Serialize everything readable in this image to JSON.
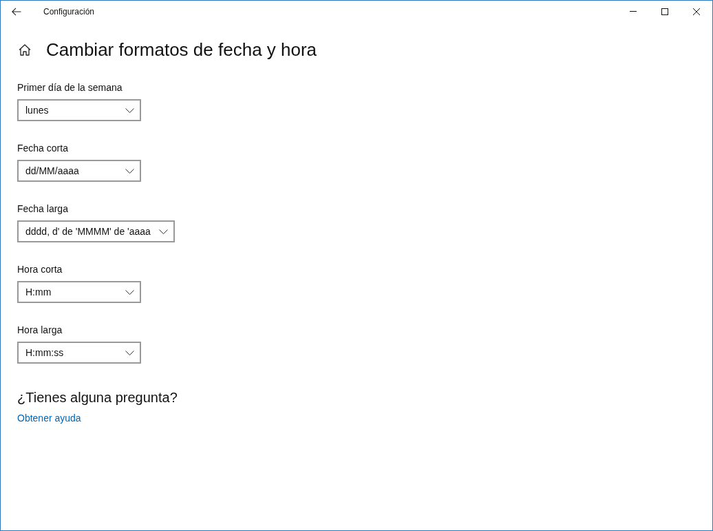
{
  "window": {
    "title": "Configuración"
  },
  "page": {
    "title": "Cambiar formatos de fecha y hora"
  },
  "settings": [
    {
      "label": "Primer día de la semana",
      "value": "lunes"
    },
    {
      "label": "Fecha corta",
      "value": "dd/MM/aaaa"
    },
    {
      "label": "Fecha larga",
      "value": "dddd, d' de 'MMMM' de 'aaaa"
    },
    {
      "label": "Hora corta",
      "value": "H:mm"
    },
    {
      "label": "Hora larga",
      "value": "H:mm:ss"
    }
  ],
  "help": {
    "heading": "¿Tienes alguna pregunta?",
    "link": "Obtener ayuda"
  }
}
